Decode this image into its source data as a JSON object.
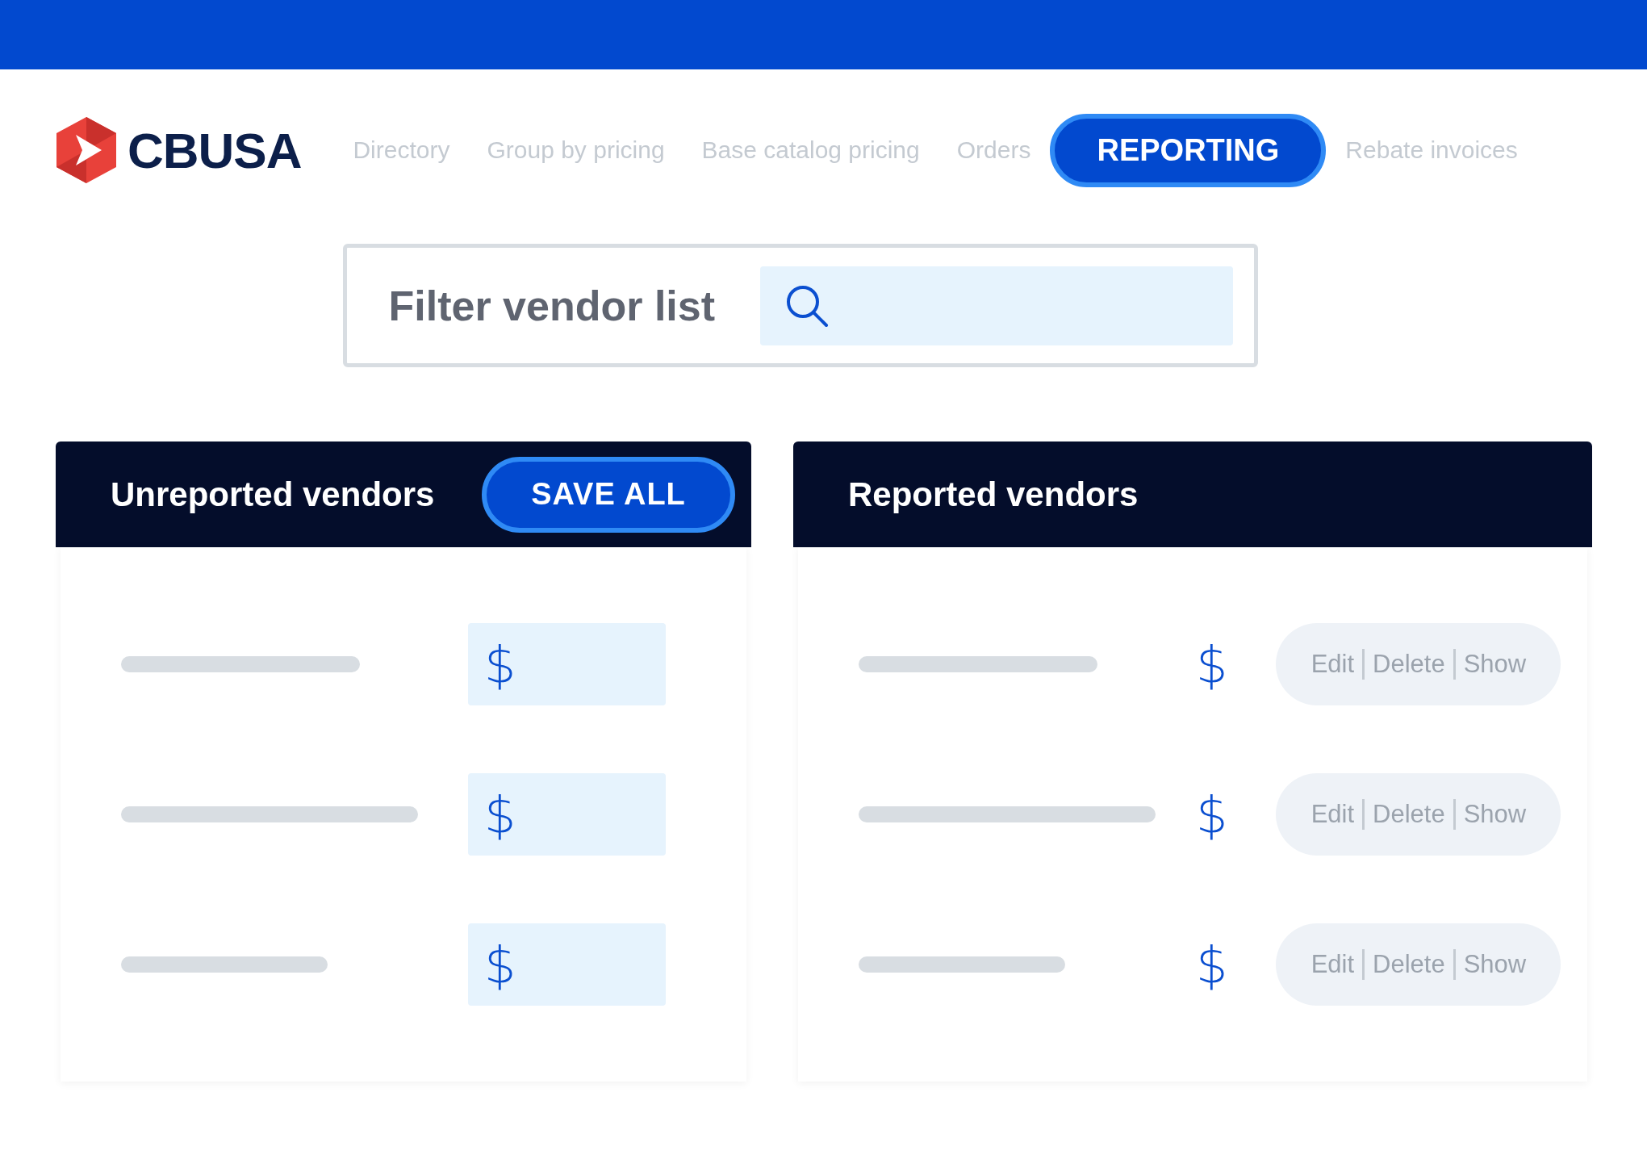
{
  "brand": {
    "name": "CBUSA"
  },
  "nav": [
    {
      "label": "Directory",
      "selected": false
    },
    {
      "label": "Group by pricing",
      "selected": false
    },
    {
      "label": "Base catalog pricing",
      "selected": false
    },
    {
      "label": "Orders",
      "selected": false
    },
    {
      "label": "REPORTING",
      "selected": true
    },
    {
      "label": "Rebate invoices",
      "selected": false
    }
  ],
  "filter": {
    "label": "Filter vendor list"
  },
  "unreported": {
    "title": "Unreported vendors",
    "button": "SAVE ALL",
    "rows": [
      {
        "symbol": "$"
      },
      {
        "symbol": "$"
      },
      {
        "symbol": "$"
      }
    ]
  },
  "reported": {
    "title": "Reported vendors",
    "rows": [
      {
        "symbol": "$",
        "actions": [
          "Edit",
          "Delete",
          "Show"
        ]
      },
      {
        "symbol": "$",
        "actions": [
          "Edit",
          "Delete",
          "Show"
        ]
      },
      {
        "symbol": "$",
        "actions": [
          "Edit",
          "Delete",
          "Show"
        ]
      }
    ]
  }
}
